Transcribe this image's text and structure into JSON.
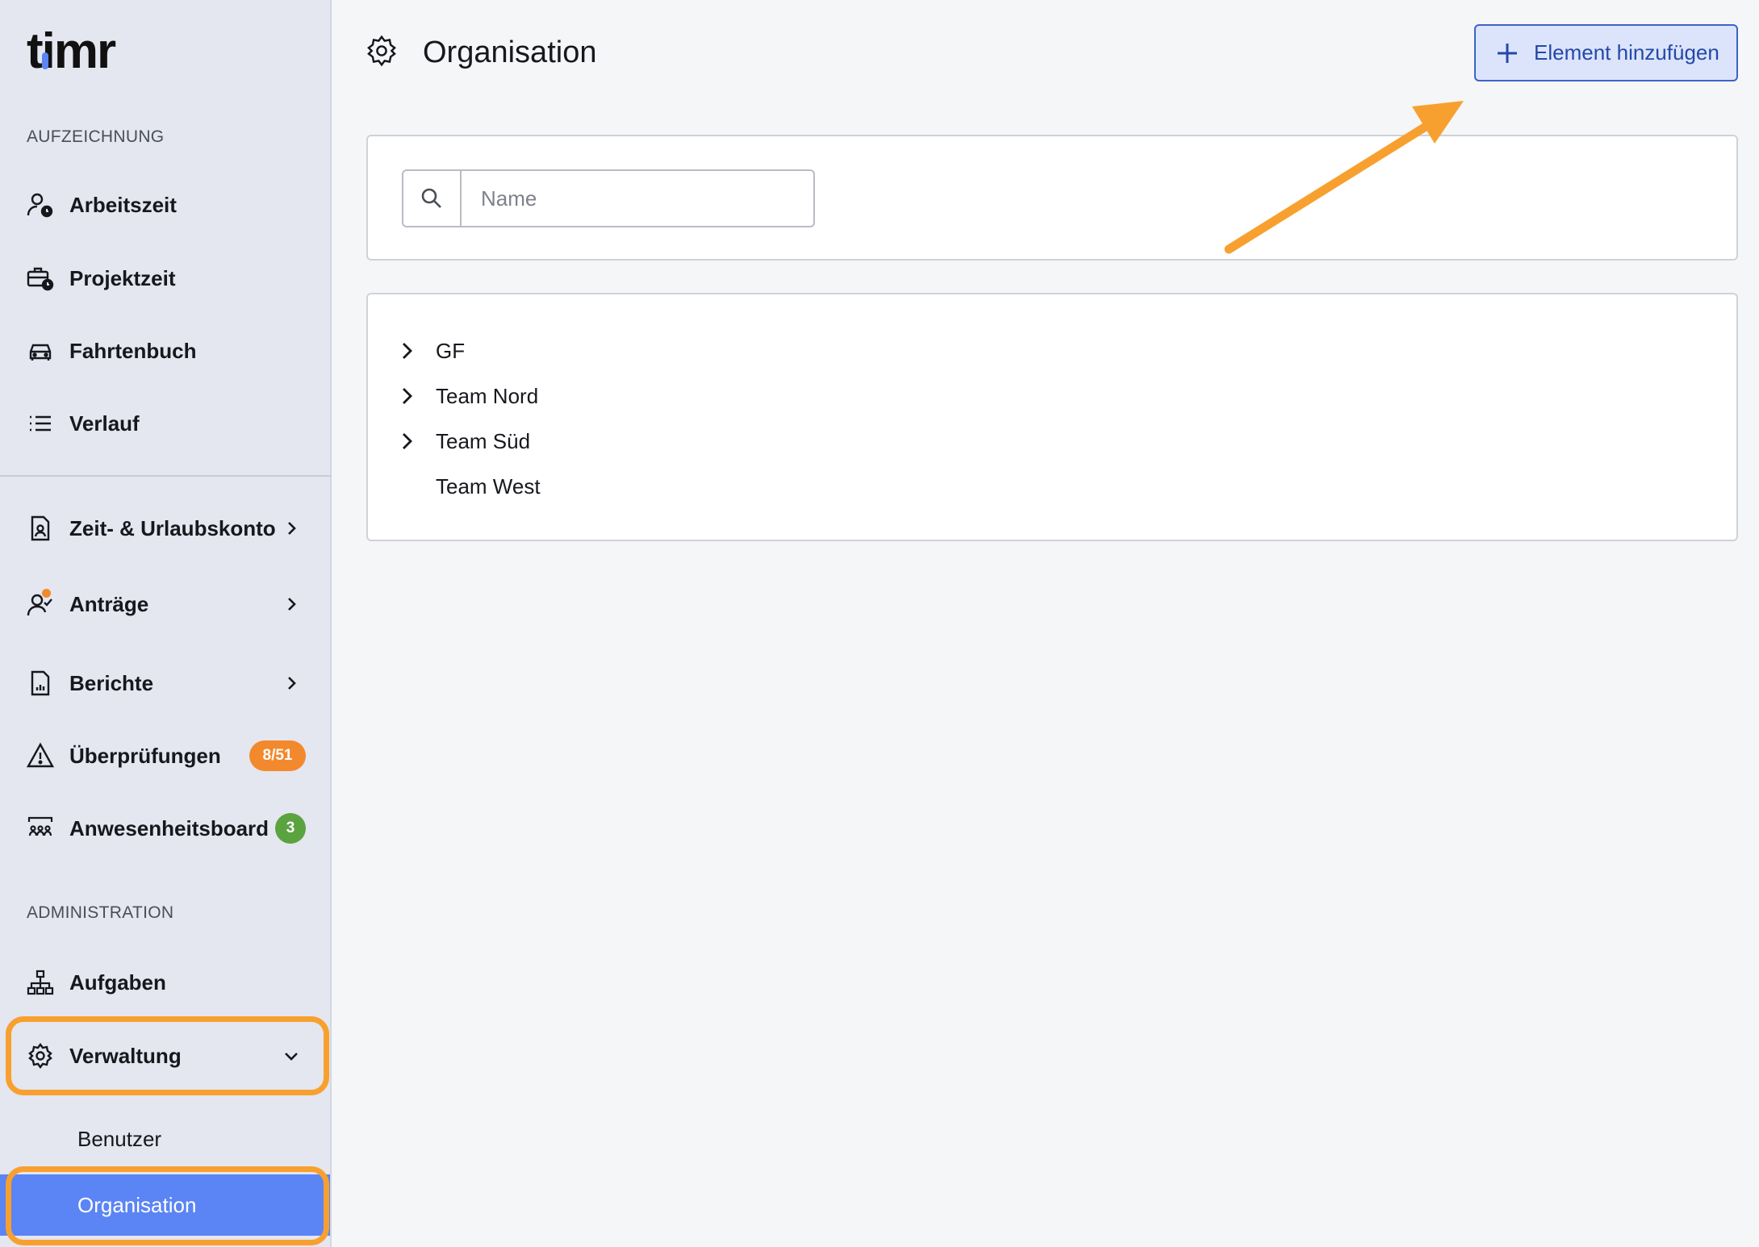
{
  "app": {
    "logo_text": "timr"
  },
  "sidebar": {
    "section_recording": "AUFZEICHNUNG",
    "recording_items": [
      {
        "label": "Arbeitszeit",
        "icon": "user-clock-icon"
      },
      {
        "label": "Projektzeit",
        "icon": "briefcase-clock-icon"
      },
      {
        "label": "Fahrtenbuch",
        "icon": "car-icon"
      },
      {
        "label": "Verlauf",
        "icon": "list-icon"
      }
    ],
    "account_items": [
      {
        "label": "Zeit- & Urlaubskonto",
        "icon": "document-user-icon"
      },
      {
        "label": "Anträge",
        "icon": "user-check-icon"
      },
      {
        "label": "Berichte",
        "icon": "report-icon"
      },
      {
        "label": "Überprüfungen",
        "icon": "warning-icon",
        "badge": "8/51",
        "badge_color": "#f2892d"
      },
      {
        "label": "Anwesenheitsboard",
        "icon": "presence-board-icon",
        "badge": "3",
        "badge_color": "#5aa33f"
      }
    ],
    "section_admin": "ADMINISTRATION",
    "admin_items": [
      {
        "label": "Aufgaben",
        "icon": "hierarchy-icon"
      },
      {
        "label": "Verwaltung",
        "icon": "gear-icon"
      }
    ],
    "sub_items": [
      {
        "label": "Benutzer"
      },
      {
        "label": "Organisation",
        "active": true
      }
    ]
  },
  "header": {
    "title": "Organisation",
    "icon": "gear-icon",
    "add_button_label": "Element hinzufügen"
  },
  "search": {
    "placeholder": "Name",
    "value": ""
  },
  "tree": [
    {
      "label": "GF",
      "expandable": true
    },
    {
      "label": "Team Nord",
      "expandable": true
    },
    {
      "label": "Team Süd",
      "expandable": true
    },
    {
      "label": "Team West",
      "expandable": false
    }
  ],
  "colors": {
    "accent": "#5b84f5",
    "highlight": "#f8a02f",
    "button_bg": "#dbe4fb",
    "button_text": "#2548a8"
  }
}
